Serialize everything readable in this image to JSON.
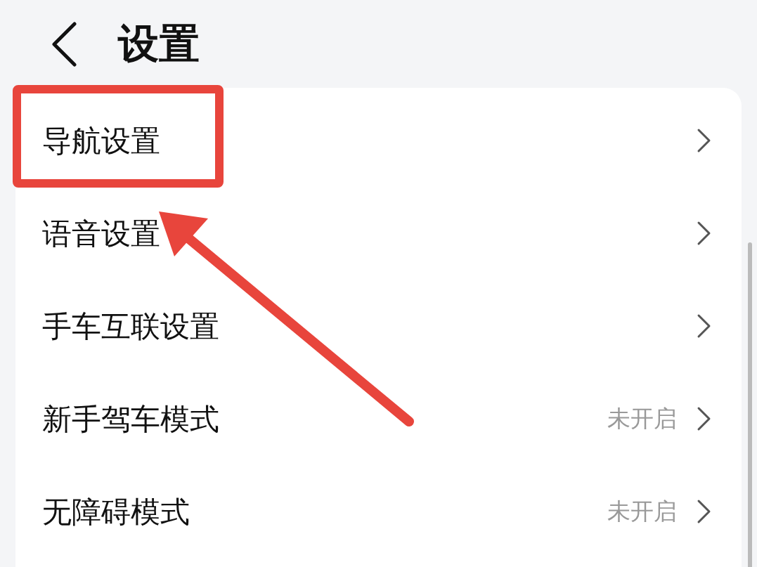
{
  "header": {
    "title": "设置"
  },
  "items": [
    {
      "label": "导航设置",
      "highlighted": true
    },
    {
      "label": "语音设置",
      "highlighted": false
    },
    {
      "label": "手车互联设置",
      "highlighted": false
    },
    {
      "label": "新手驾车模式",
      "value": "未开启",
      "highlighted": false
    },
    {
      "label": "无障碍模式",
      "value": "未开启",
      "highlighted": false
    }
  ]
}
